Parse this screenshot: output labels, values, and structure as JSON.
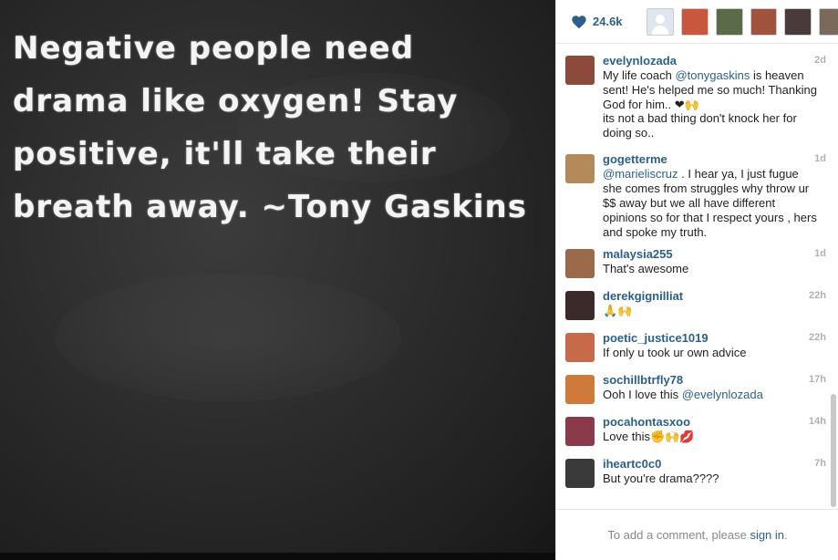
{
  "post": {
    "quote": "Negative people need drama like oxygen! Stay positive, it'll take their breath away. ~Tony Gaskins"
  },
  "likes": {
    "count": "24.6k",
    "heart_color": "#2c5f8a"
  },
  "likers": [
    {
      "color": "#dfe6ee"
    },
    {
      "color": "#c7583e"
    },
    {
      "color": "#5b6b4a"
    },
    {
      "color": "#a0523d"
    },
    {
      "color": "#4a3b3b"
    },
    {
      "color": "#7a6a5a"
    }
  ],
  "comments": [
    {
      "user": "evelynlozada",
      "time": "2d",
      "text_pre": "My life coach ",
      "mention": "@tonygaskins",
      "text_post": " is heaven sent! He's helped me so much! Thanking God for him.. ❤🙌",
      "avatar_color": "#8b4a3a"
    },
    {
      "user": "",
      "time": "",
      "text_pre": "its not a bad thing don't knock her for doing so..",
      "mention": "",
      "text_post": "",
      "avatar_color": ""
    },
    {
      "user": "gogetterme",
      "time": "1d",
      "text_pre": "",
      "mention": "@marieliscruz",
      "text_post": " . I hear ya, I just fugue she comes from struggles why throw ur $$ away but we all have different opinions so for that I respect yours , hers and spoke my truth.",
      "avatar_color": "#b58a5a"
    },
    {
      "user": "malaysia255",
      "time": "1d",
      "text_pre": "That's awesome",
      "mention": "",
      "text_post": "",
      "avatar_color": "#9a6a4a"
    },
    {
      "user": "derekgignilliat",
      "time": "22h",
      "text_pre": "🙏🙌",
      "mention": "",
      "text_post": "",
      "avatar_color": "#3a2a2a"
    },
    {
      "user": "poetic_justice1019",
      "time": "22h",
      "text_pre": "If only u took ur own advice",
      "mention": "",
      "text_post": "",
      "avatar_color": "#c76a4a"
    },
    {
      "user": "sochillbtrfly78",
      "time": "17h",
      "text_pre": "Ooh I love this ",
      "mention": "@evelynlozada",
      "text_post": "",
      "avatar_color": "#d07a3a"
    },
    {
      "user": "pocahontasxoo",
      "time": "14h",
      "text_pre": "Love this✊🙌💋",
      "mention": "",
      "text_post": "",
      "avatar_color": "#8a3a4a"
    },
    {
      "user": "iheartc0c0",
      "time": "7h",
      "text_pre": "But you're drama????",
      "mention": "",
      "text_post": "",
      "avatar_color": "#3a3a3a"
    }
  ],
  "footer": {
    "prompt": "To add a comment, please ",
    "link": "sign in",
    "suffix": "."
  }
}
